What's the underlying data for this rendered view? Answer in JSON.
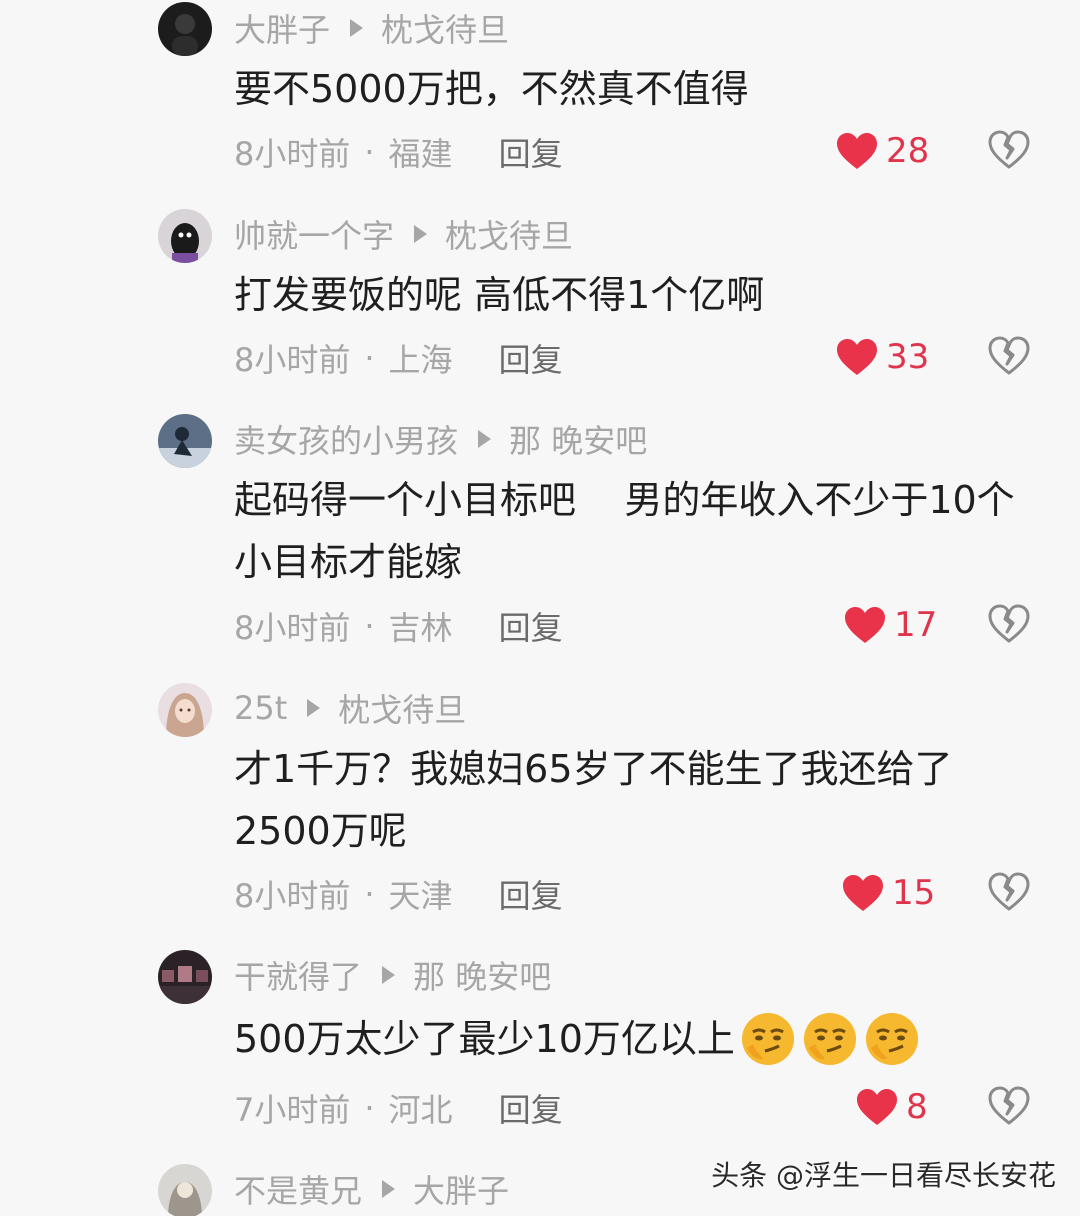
{
  "comments": [
    {
      "user": "大胖子",
      "reply_to": "枕戈待旦",
      "lines": [
        "要不5000万把，不然真不值得"
      ],
      "time": "8小时前",
      "location": "福建",
      "reply_label": "回复",
      "likes": "28"
    },
    {
      "user": "帅就一个字",
      "reply_to": "枕戈待旦",
      "lines": [
        "打发要饭的呢 高低不得1个亿啊"
      ],
      "time": "8小时前",
      "location": "上海",
      "reply_label": "回复",
      "likes": "33"
    },
    {
      "user": "卖女孩的小男孩",
      "reply_to": "那 晚安吧",
      "lines": [
        "起码得一个小目标吧    男的年收入不少于10个",
        "小目标才能嫁"
      ],
      "time": "8小时前",
      "location": "吉林",
      "reply_label": "回复",
      "likes": "17"
    },
    {
      "user": "25t",
      "reply_to": "枕戈待旦",
      "lines": [
        "才1千万？我媳妇65岁了不能生了我还给了",
        "2500万呢"
      ],
      "time": "8小时前",
      "location": "天津",
      "reply_label": "回复",
      "likes": "15"
    },
    {
      "user": "干就得了",
      "reply_to": "那 晚安吧",
      "lines": [
        "500万太少了最少10万亿以上"
      ],
      "time": "7小时前",
      "location": "河北",
      "reply_label": "回复",
      "likes": "8",
      "emojis": [
        "thinking-smirk-emoji",
        "thinking-smirk-emoji",
        "thinking-smirk-emoji"
      ]
    },
    {
      "user": "不是黄兄",
      "reply_to": "大胖子"
    }
  ],
  "separator": "·",
  "icons": {
    "like": "heart-icon",
    "dislike": "broken-heart-icon",
    "reply_marker": "play-triangle-icon"
  },
  "colors": {
    "background": "#f7f7f7",
    "like_red": "#e0344c",
    "muted_text": "#a6a6a6",
    "body_text": "#1f1f1f"
  },
  "watermark": "头条 @浮生一日看尽长安花"
}
